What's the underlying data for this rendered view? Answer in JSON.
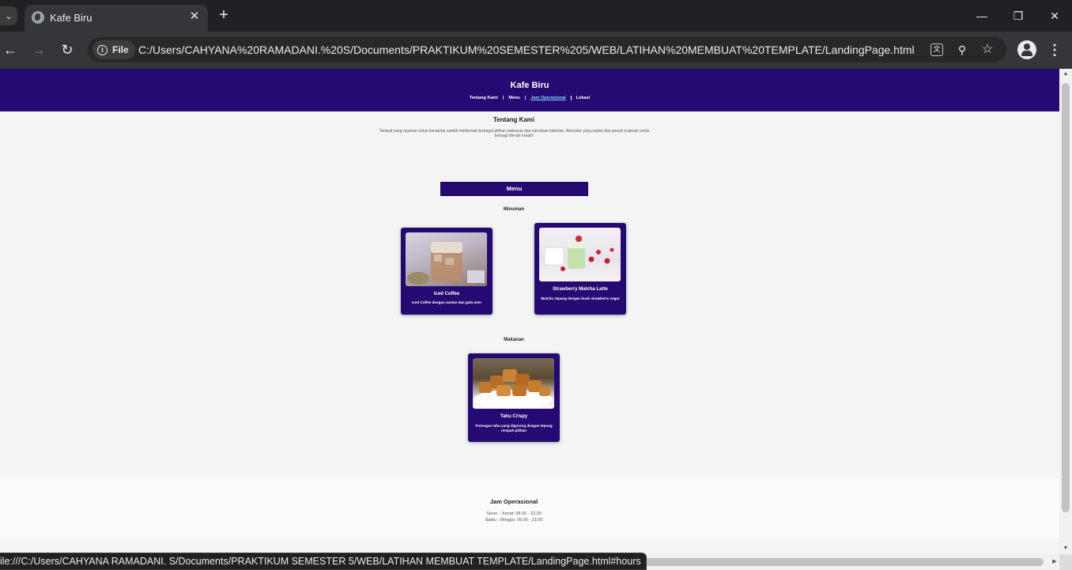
{
  "browser": {
    "tab_title": "Kafe Biru",
    "file_label": "File",
    "url": "C:/Users/CAHYANA%20RAMADANI.%20S/Documents/PRAKTIKUM%20SEMESTER%205/WEB/LATIHAN%20MEMBUAT%20TEMPLATE/LandingPage.html",
    "status_url": "ile:///C:/Users/CAHYANA RAMADANI. S/Documents/PRAKTIKUM SEMESTER 5/WEB/LATIHAN MEMBUAT TEMPLATE/LandingPage.html#hours"
  },
  "site": {
    "title": "Kafe Biru",
    "nav": [
      "Tentang Kami",
      "Menu",
      "Jam Operasional",
      "Lokasi"
    ],
    "active_nav": "Jam Operasional"
  },
  "about": {
    "title": "Tentang Kami",
    "text": "Tempat yang nyaman untuk bersantai sambil menikmati berbagai pilihan makanan dan minuman kekinian. Atmosfer yang santai dan penuh inspirasi untuk berbagi ide-ide kreatif."
  },
  "menu": {
    "title": "Menu",
    "drinks_label": "Minuman",
    "food_label": "Makanan",
    "drinks": [
      {
        "name": "Iced Coffee",
        "desc": "Iced Coffee dengan santan dan gula aren"
      },
      {
        "name": "Strawberry Matcha Latte",
        "desc": "Matcha Jepang dengan buah strawberry segar"
      }
    ],
    "food": [
      {
        "name": "Tahu Crispy",
        "desc": "Potongan tahu yang digoreng dengan tepung rempah pilihan"
      }
    ]
  },
  "hours": {
    "title": "Jam Operasional",
    "weekdays": "Senin - Jumat: 08.00 - 22.00",
    "weekend": "Sabtu - Minggu: 09.00 - 23.00"
  },
  "colors": {
    "brand": "#260a73",
    "active_link": "#7fd6ff"
  }
}
